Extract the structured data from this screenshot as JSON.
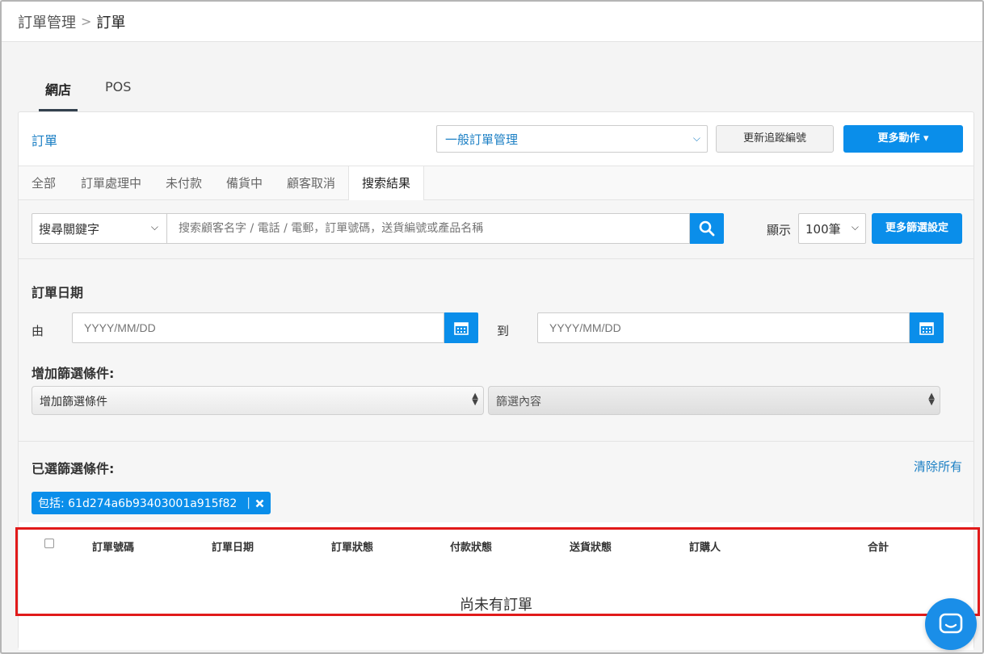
{
  "breadcrumb": {
    "parent": "訂單管理",
    "separator": ">",
    "current": "訂單"
  },
  "top_tabs": [
    {
      "label": "網店",
      "active": true
    },
    {
      "label": "POS",
      "active": false
    }
  ],
  "panel": {
    "title": "訂單",
    "management_select": "一般訂單管理",
    "tracking_button": "更新追蹤編號",
    "more_actions_button": "更多動作 ▾"
  },
  "status_tabs": [
    {
      "label": "全部",
      "active": false
    },
    {
      "label": "訂單處理中",
      "active": false
    },
    {
      "label": "未付款",
      "active": false
    },
    {
      "label": "備貨中",
      "active": false
    },
    {
      "label": "顧客取消",
      "active": false
    },
    {
      "label": "搜索結果",
      "active": true
    }
  ],
  "search": {
    "keyword_select": "搜尋關鍵字",
    "placeholder": "搜索顧客名字 / 電話 / 電郵，訂單號碼，送貨編號或產品名稱",
    "show_label": "顯示",
    "count_select": "100筆",
    "more_filter_button": "更多篩選設定"
  },
  "filters": {
    "order_date_label": "訂單日期",
    "from_label": "由",
    "to_label": "到",
    "date_placeholder": "YYYY/MM/DD",
    "add_filter_label": "增加篩選條件:",
    "add_filter_select": "增加篩選條件",
    "filter_content_select": "篩選內容"
  },
  "selected": {
    "label": "已選篩選條件:",
    "clear_all": "清除所有",
    "chip_text": "包括: 61d274a6b93403001a915f82",
    "chip_separator": "|"
  },
  "table": {
    "columns": [
      "訂單號碼",
      "訂單日期",
      "訂單狀態",
      "付款狀態",
      "送貨狀態",
      "訂購人",
      "合計"
    ],
    "empty_message": "尚未有訂單"
  },
  "colors": {
    "accent": "#0a8eea",
    "link": "#1b7fc4",
    "highlight": "#e11a1a"
  },
  "icons": {
    "search": "search-icon",
    "calendar": "calendar-icon",
    "chat": "chat-icon",
    "close": "close-icon"
  }
}
